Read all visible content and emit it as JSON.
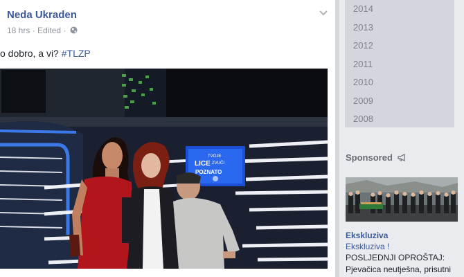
{
  "post": {
    "author": "Neda Ukraden",
    "time": "18 hrs",
    "edited": "Edited",
    "text": "o dobro, a vi? ",
    "hashtag": "#TLZP",
    "photo": {
      "screen_line1": "TVOJE",
      "screen_line2": "LICE",
      "screen_line3": "ZVUČI",
      "screen_line4": "POZNATO"
    }
  },
  "sidebar": {
    "years": [
      "2014",
      "2013",
      "2012",
      "2011",
      "2010",
      "2009",
      "2008"
    ],
    "sponsored_label": "Sponsored",
    "ad": {
      "title": "Ekskluziva",
      "subtitle": "Ekskluziva !",
      "body": "POSLJEDNJI OPROŠTAJ: Pjevačica neutješna, prisutni"
    }
  },
  "colors": {
    "link": "#3b5998",
    "meta": "#90949c",
    "year_panel": "#d3d6dc",
    "dress_red": "#b3151c"
  },
  "icons": [
    "globe-icon",
    "chevron-down-icon",
    "megaphone-icon"
  ]
}
